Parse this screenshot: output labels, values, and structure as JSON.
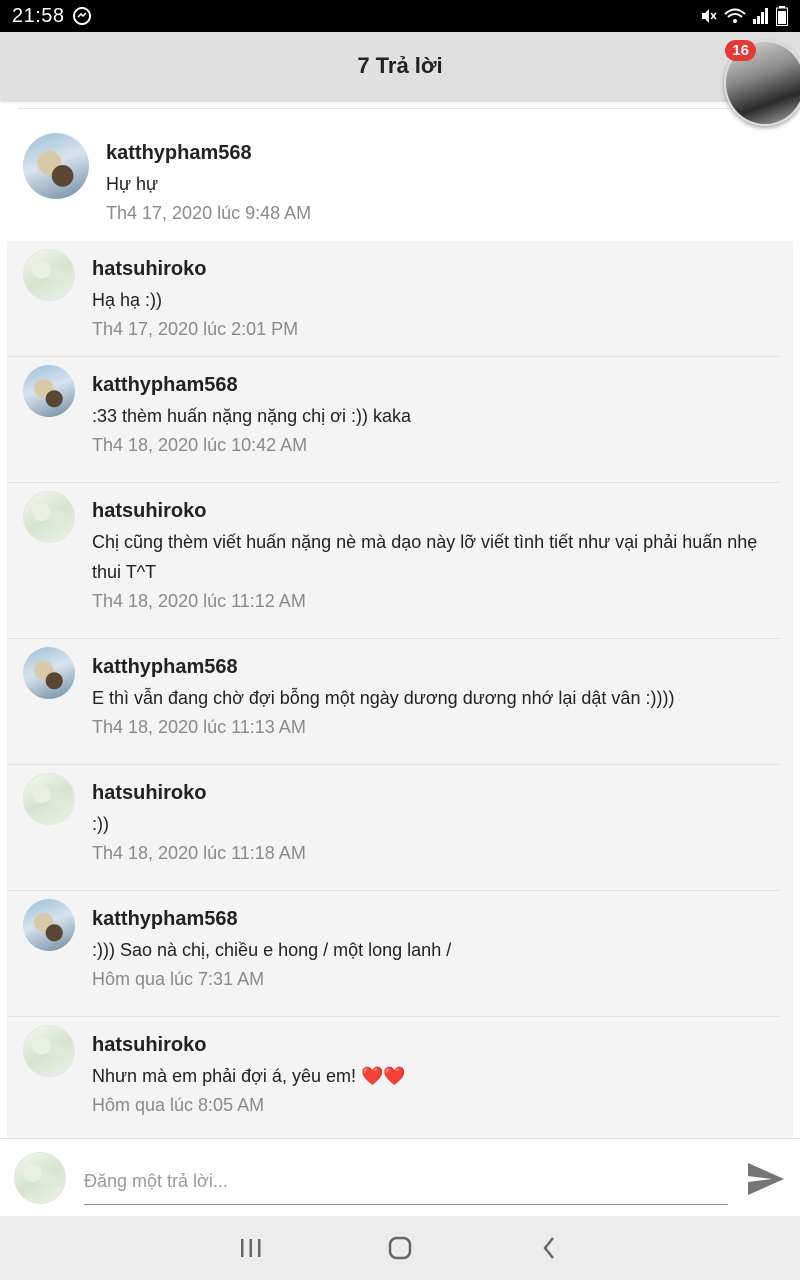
{
  "status_bar": {
    "time": "21:58"
  },
  "header": {
    "title": "7 Trả lời",
    "badge_count": "16"
  },
  "main_comment": {
    "author": "katthypham568",
    "text": "Hự hự",
    "time": "Th4 17, 2020 lúc 9:48 AM"
  },
  "replies": [
    {
      "author": "hatsuhiroko",
      "text": "Hạ hạ :))",
      "time": "Th4 17, 2020 lúc 2:01 PM"
    },
    {
      "author": "katthypham568",
      "text": ":33 thèm huấn nặng nặng chị ơi :)) kaka",
      "time": "Th4 18, 2020 lúc 10:42 AM"
    },
    {
      "author": "hatsuhiroko",
      "text": "Chị cũng thèm viết huấn nặng nè mà dạo này lỡ viết tình tiết như vại phải huấn nhẹ thui T^T",
      "time": "Th4 18, 2020 lúc 11:12 AM"
    },
    {
      "author": "katthypham568",
      "text": "E thì vẫn đang chờ đợi bỗng một ngày dương dương nhớ lại dật vân :))))",
      "time": "Th4 18, 2020 lúc 11:13 AM"
    },
    {
      "author": "hatsuhiroko",
      "text": ":))",
      "time": "Th4 18, 2020 lúc 11:18 AM"
    },
    {
      "author": "katthypham568",
      "text": ":))) Sao nà chị, chiều e hong / một long lanh /",
      "time": "Hôm qua lúc 7:31 AM"
    },
    {
      "author": "hatsuhiroko",
      "text": "Nhưn mà em phải đợi á, yêu em! ❤️❤️",
      "time": "Hôm qua lúc 8:05 AM"
    }
  ],
  "compose": {
    "placeholder": "Đăng một trả lời..."
  },
  "colors": {
    "header_bg": "#e0e0e0",
    "badge": "#e53935",
    "reply_bg": "#f4f4f4",
    "timestamp": "#8a8a8a"
  }
}
